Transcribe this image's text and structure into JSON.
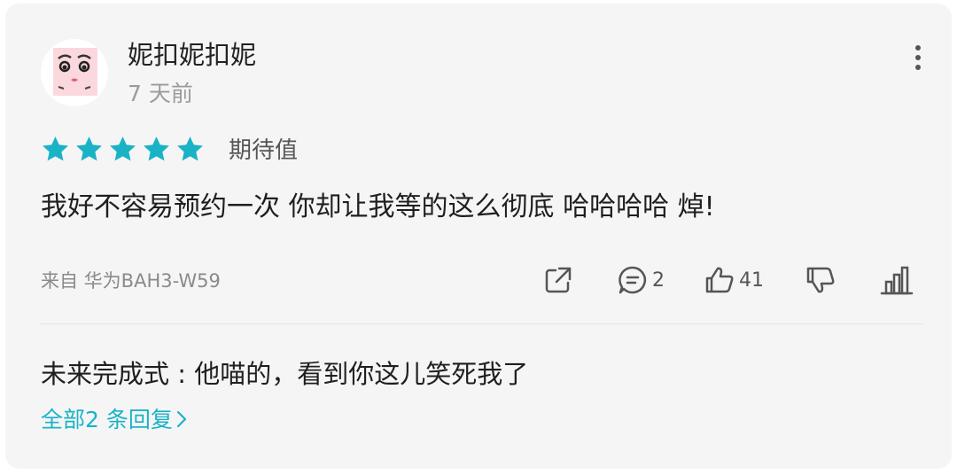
{
  "review": {
    "user": {
      "name": "妮扣妮扣妮",
      "avatar": "avatar-face-image"
    },
    "time_ago": "7 天前",
    "rating": {
      "stars": 5,
      "max": 5,
      "label": "期待值"
    },
    "text": "我好不容易预约一次 你却让我等的这么彻底 哈哈哈哈 焯!",
    "device": "来自 华为BAH3-W59",
    "actions": {
      "share_icon": "share-icon",
      "comment_icon": "comment-icon",
      "comment_count": "2",
      "like_icon": "thumbs-up-icon",
      "like_count": "41",
      "dislike_icon": "thumbs-down-icon",
      "stats_icon": "bar-chart-icon"
    },
    "more_icon": "more-vertical-icon"
  },
  "top_reply": {
    "text": "未来完成式 : 他喵的，看到你这儿笑死我了",
    "all_replies_label": "全部2 条回复",
    "all_replies_icon": "chevron-right-icon"
  },
  "colors": {
    "accent": "#1ab3c6",
    "star": "#1ab3c6",
    "card_background": "#f5f5f6"
  }
}
